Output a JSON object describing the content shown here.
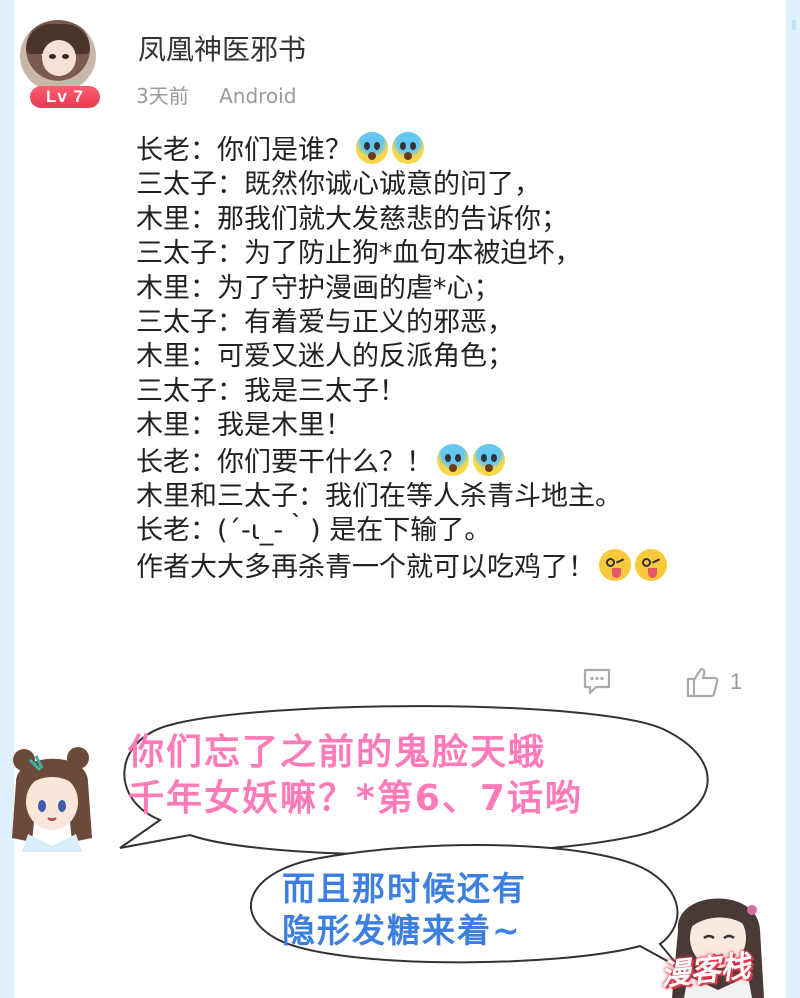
{
  "post": {
    "username": "凤凰神医邪书",
    "level": "Lv 7",
    "time": "3天前",
    "device": "Android",
    "lines": [
      "长老：你们是谁？",
      "三太子：既然你诚心诚意的问了，",
      "木里：那我们就大发慈悲的告诉你；",
      "三太子：为了防止狗*血句本被迫坏，",
      "木里：为了守护漫画的虐*心；",
      "三太子：有着爱与正义的邪恶，",
      "木里：可爱又迷人的反派角色；",
      "三太子：我是三太子！",
      "木里：我是木里！",
      "长老：你们要干什么？！",
      "木里和三太子：我们在等人杀青斗地主。",
      "长老：(´-ι_-｀) 是在下输了。",
      "作者大大多再杀青一个就可以吃鸡了！"
    ],
    "like_count": "1"
  },
  "bubbles": {
    "pink_line1": "你们忘了之前的鬼脸天蛾",
    "pink_line2": "千年女妖嘛？*第6、7话哟",
    "blue_line1": "而且那时候还有",
    "blue_line2": "隐形发糖来着~"
  },
  "watermark": "漫客栈",
  "icons": {
    "comment": "comment-icon",
    "like": "thumbs-up-icon",
    "fear_emoji": "fearful-face-emoji",
    "tongue_emoji": "winking-tongue-face-emoji"
  },
  "colors": {
    "pink_text": "#ff7ab8",
    "blue_text": "#3c7fe0",
    "level_badge": "#e83a55",
    "side_border": "#dff2fb"
  }
}
